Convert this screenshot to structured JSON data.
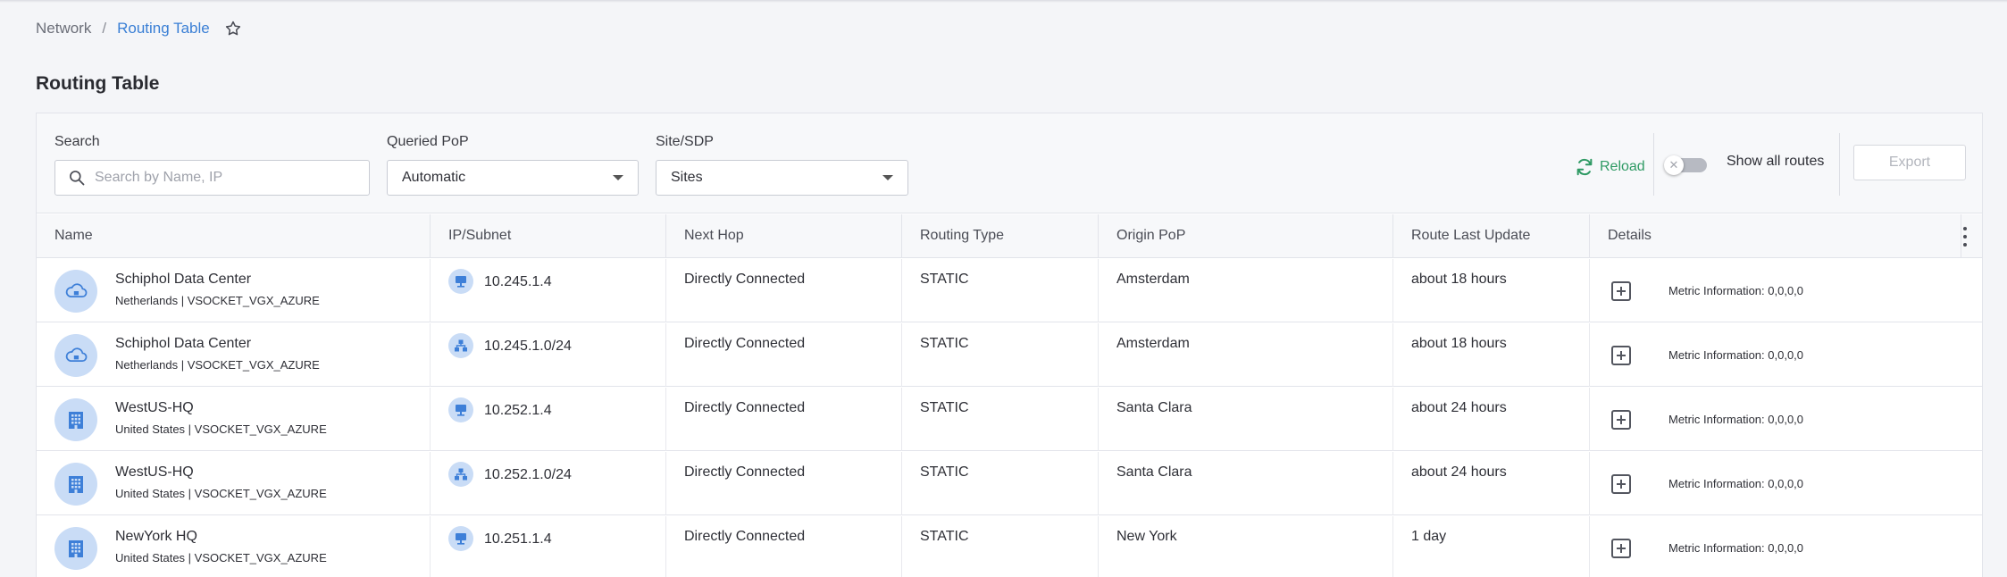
{
  "breadcrumb": {
    "parent": "Network",
    "separator": "/",
    "current": "Routing Table"
  },
  "page": {
    "title": "Routing Table"
  },
  "filters": {
    "search_label": "Search",
    "search_placeholder": "Search by Name, IP",
    "pop_label": "Queried PoP",
    "pop_value": "Automatic",
    "site_label": "Site/SDP",
    "site_value": "Sites"
  },
  "actions": {
    "reload_label": "Reload",
    "show_all_routes_label": "Show all routes",
    "show_all_routes_on": false,
    "export_label": "Export"
  },
  "colors": {
    "accent_link": "#3a7fd5",
    "reload_green": "#2f9a64",
    "icon_bg": "#c9dcf6",
    "icon_fg": "#3d7fd8"
  },
  "table": {
    "columns": [
      "Name",
      "IP/Subnet",
      "Next Hop",
      "Routing Type",
      "Origin PoP",
      "Route Last Update",
      "Details"
    ],
    "rows": [
      {
        "name": "Schiphol Data Center",
        "sub": "Netherlands | VSOCKET_VGX_AZURE",
        "site_icon": "cloud-icon",
        "ip": "10.245.1.4",
        "ip_icon": "host-icon",
        "next_hop": "Directly Connected",
        "routing_type": "STATIC",
        "origin_pop": "Amsterdam",
        "last_update": "about 18 hours",
        "details": "Metric Information: 0,0,0,0"
      },
      {
        "name": "Schiphol Data Center",
        "sub": "Netherlands | VSOCKET_VGX_AZURE",
        "site_icon": "cloud-icon",
        "ip": "10.245.1.0/24",
        "ip_icon": "subnet-icon",
        "next_hop": "Directly Connected",
        "routing_type": "STATIC",
        "origin_pop": "Amsterdam",
        "last_update": "about 18 hours",
        "details": "Metric Information: 0,0,0,0"
      },
      {
        "name": "WestUS-HQ",
        "sub": "United States | VSOCKET_VGX_AZURE",
        "site_icon": "building-icon",
        "ip": "10.252.1.4",
        "ip_icon": "host-icon",
        "next_hop": "Directly Connected",
        "routing_type": "STATIC",
        "origin_pop": "Santa Clara",
        "last_update": "about 24 hours",
        "details": "Metric Information: 0,0,0,0"
      },
      {
        "name": "WestUS-HQ",
        "sub": "United States | VSOCKET_VGX_AZURE",
        "site_icon": "building-icon",
        "ip": "10.252.1.0/24",
        "ip_icon": "subnet-icon",
        "next_hop": "Directly Connected",
        "routing_type": "STATIC",
        "origin_pop": "Santa Clara",
        "last_update": "about 24 hours",
        "details": "Metric Information: 0,0,0,0"
      },
      {
        "name": "NewYork HQ",
        "sub": "United States | VSOCKET_VGX_AZURE",
        "site_icon": "building-icon",
        "ip": "10.251.1.4",
        "ip_icon": "host-icon",
        "next_hop": "Directly Connected",
        "routing_type": "STATIC",
        "origin_pop": "New York",
        "last_update": "1 day",
        "details": "Metric Information: 0,0,0,0"
      }
    ]
  }
}
